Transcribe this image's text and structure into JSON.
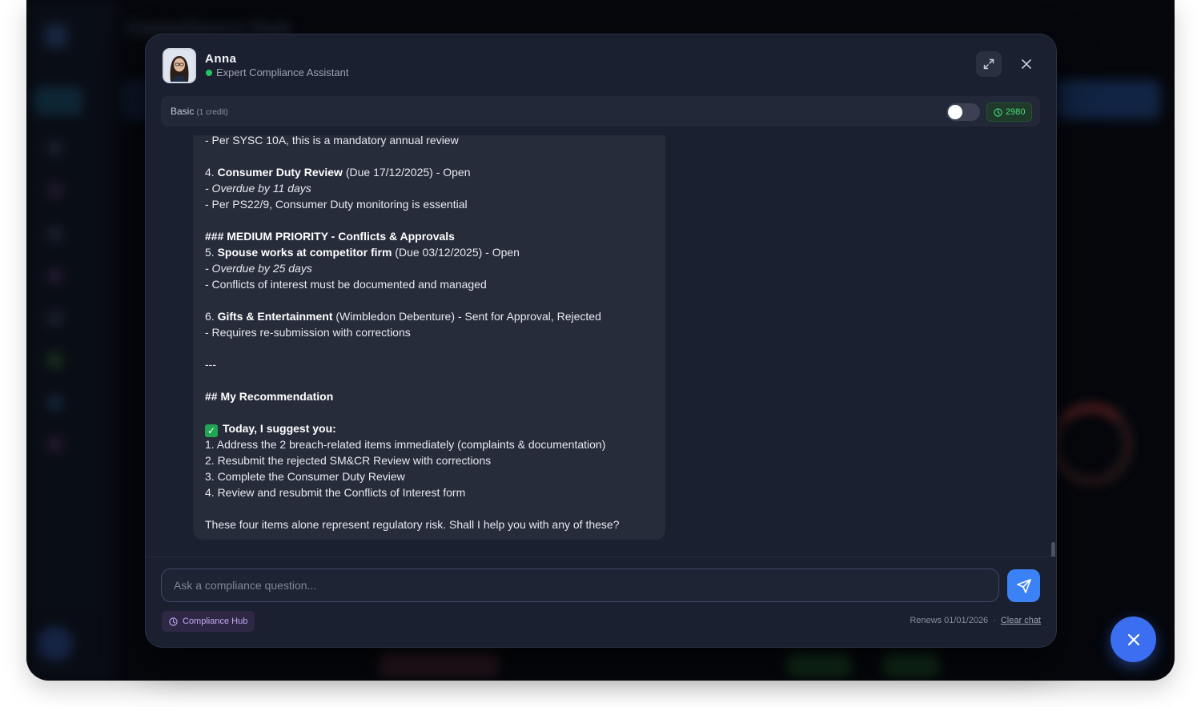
{
  "background_app": {
    "title": "Compliance Hub"
  },
  "assistant": {
    "name": "Anna",
    "role": "Expert Compliance Assistant",
    "status_color": "#22c55e"
  },
  "toolbar": {
    "mode_label": "Basic",
    "mode_credit": "(1 credit)",
    "toggle_on": false,
    "credits": "2980"
  },
  "message": {
    "lines": [
      {
        "text": "- Per SYSC 10A, this is a mandatory annual review"
      },
      {
        "prefix": "4. ",
        "bold": "Consumer Duty Review",
        "rest": " (Due 17/12/2025) - Open"
      },
      {
        "italic": "- Overdue by 11 days"
      },
      {
        "text": "- Per PS22/9, Consumer Duty monitoring is essential"
      },
      {
        "bold": "### MEDIUM PRIORITY - Conflicts & Approvals"
      },
      {
        "prefix": "5. ",
        "bold": "Spouse works at competitor firm",
        "rest": " (Due 03/12/2025) - Open"
      },
      {
        "italic": "- Overdue by 25 days"
      },
      {
        "text": "- Conflicts of interest must be documented and managed"
      },
      {
        "prefix": "6. ",
        "bold": "Gifts & Entertainment",
        "rest": " (Wimbledon Debenture) - Sent for Approval, Rejected"
      },
      {
        "text": "- Requires re-submission with corrections"
      },
      {
        "text": "---"
      },
      {
        "bold": "## My Recommendation"
      },
      {
        "check": "✓",
        "bold": "Today, I suggest you:"
      },
      {
        "text": "1. Address the 2 breach-related items immediately (complaints & documentation)"
      },
      {
        "text": "2. Resubmit the rejected SM&CR Review with corrections"
      },
      {
        "text": "3. Complete the Consumer Duty Review"
      },
      {
        "text": "4. Review and resubmit the Conflicts of Interest form"
      },
      {
        "text": "These four items alone represent regulatory risk. Shall I help you with any of these?"
      }
    ]
  },
  "composer": {
    "placeholder": "Ask a compliance question...",
    "value": ""
  },
  "footer": {
    "tag_label": "Compliance Hub",
    "renews": "Renews 01/01/2026",
    "separator": "·",
    "clear_chat": "Clear chat"
  },
  "colors": {
    "accent": "#3b82f6",
    "modal_bg": "#1b2030",
    "credits_green": "#4ade80",
    "tag_purple": "#c4a8f5"
  },
  "icons": {
    "expand": "expand-icon",
    "close": "close-icon",
    "clock": "clock-icon",
    "send": "send-icon",
    "fab_close": "close-icon",
    "check": "check-icon"
  }
}
